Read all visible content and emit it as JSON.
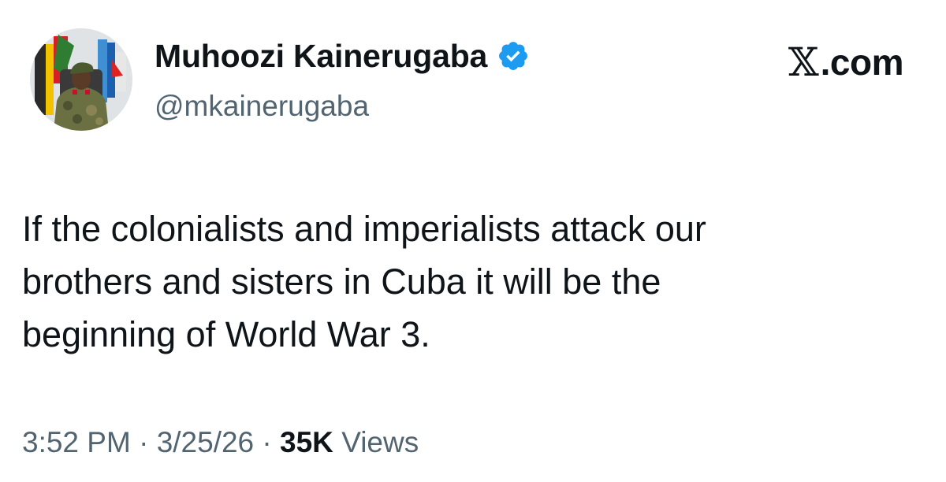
{
  "author": {
    "display_name": "Muhoozi Kainerugaba",
    "handle": "@mkainerugaba",
    "verified": true,
    "avatar_icon": "profile-photo-military-uniform",
    "verified_icon": "verified-badge-icon",
    "verified_color": "#1d9bf0"
  },
  "brand": {
    "logo": "𝕏",
    "domain": ".com"
  },
  "tweet": {
    "text": "If the colonialists and imperialists attack our\nbrothers and sisters in Cuba it will be the\nbeginning of World War 3."
  },
  "meta": {
    "time": "3:52 PM",
    "separator": " · ",
    "date": "3/25/26",
    "views_count": "35K",
    "views_label": " Views"
  },
  "colors": {
    "text_primary": "#0f1419",
    "text_secondary": "#536471",
    "background": "#ffffff"
  }
}
